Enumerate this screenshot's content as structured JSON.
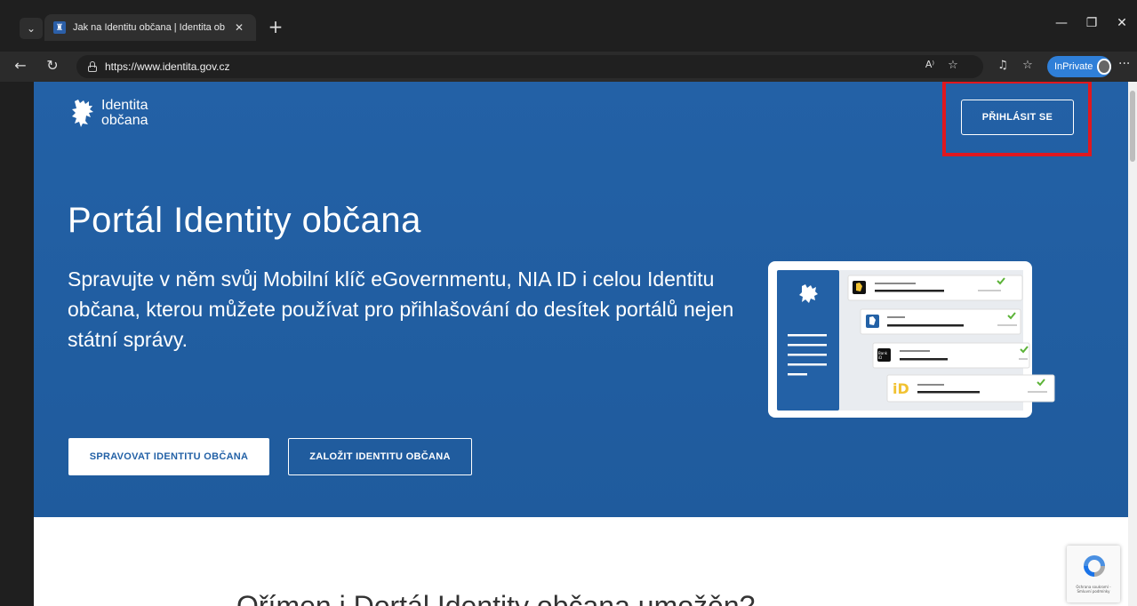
{
  "browser": {
    "tab_title": "Jak na Identitu občana | Identita ob",
    "tab_close": "✕",
    "new_tab": "+",
    "url": "https://www.identita.gov.cz",
    "inprivate_label": "InPrivate",
    "minimize": "—",
    "restore": "❐",
    "close": "✕",
    "more": "···"
  },
  "page": {
    "logo_line1": "Identita",
    "logo_line2": "občana",
    "login_button": "PŘIHLÁSIT SE",
    "hero_title": "Portál Identity občana",
    "hero_subtitle": "Spravujte v něm svůj Mobilní klíč eGovernmentu, NIA ID i celou Identitu občana, kterou můžete používat pro přihlašování do desítek portálů nejen státní správy.",
    "manage_button": "SPRAVOVAT IDENTITU OBČANA",
    "create_button": "ZALOŽIT IDENTITU OBČANA",
    "section_title_partial": "Ořímen i Dortál Identity občana umožěn?",
    "recaptcha_text": "Ochrana soukromí - Smluvní podmínky"
  },
  "colors": {
    "hero_blue": "#2361a6",
    "highlight_red": "#e0181f",
    "check_green": "#5cb338"
  }
}
